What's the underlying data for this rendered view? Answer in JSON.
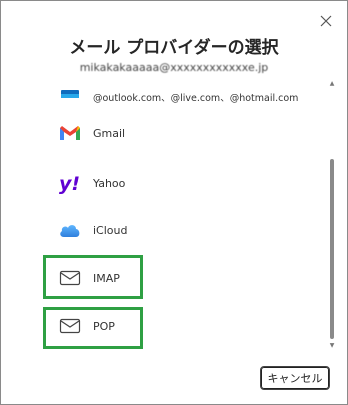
{
  "dialog": {
    "title": "メール プロバイダーの選択",
    "email": "mikakakaaaaa@xxxxxxxxxxxxe.jp",
    "close_label": "×"
  },
  "providers": [
    {
      "label": "@outlook.com、@live.com、@hotmail.com",
      "icon": "outlook-icon"
    },
    {
      "label": "Gmail",
      "icon": "gmail-icon"
    },
    {
      "label": "Yahoo",
      "icon": "yahoo-icon"
    },
    {
      "label": "iCloud",
      "icon": "icloud-icon"
    },
    {
      "label": "IMAP",
      "icon": "mail-envelope-icon"
    },
    {
      "label": "POP",
      "icon": "mail-envelope-icon"
    }
  ],
  "cancel_label": "キャンセル",
  "colors": {
    "highlight": "#2ea043",
    "gmail_red": "#ea4335",
    "yahoo_purple": "#6001d2",
    "icloud_blue": "#3a8ee6",
    "outlook_blue": "#0f6cbd"
  }
}
